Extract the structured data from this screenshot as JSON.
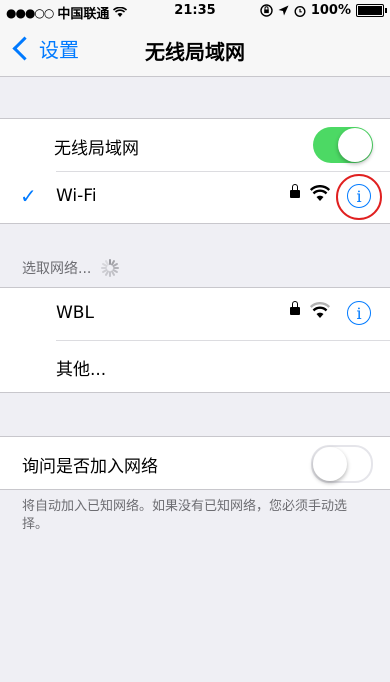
{
  "status_bar": {
    "signal_dots": "●●●○○",
    "carrier": "中国联通",
    "time": "21:35",
    "battery": "100%"
  },
  "nav": {
    "back_label": "设置",
    "title": "无线局域网"
  },
  "wifi_group": {
    "toggle_label": "无线局域网",
    "toggle_on": true,
    "connected_network": "Wi-Fi",
    "check_glyph": "✓",
    "info_glyph": "i"
  },
  "choose_network": {
    "header": "选取网络..."
  },
  "networks": [
    {
      "name": "WBL",
      "locked": true
    },
    {
      "name": "其他..."
    }
  ],
  "ask_join": {
    "label": "询问是否加入网络",
    "toggle_on": false,
    "footer": "将自动加入已知网络。如果没有已知网络，您必须手动选择。"
  },
  "colors": {
    "accent": "#007aff",
    "toggle_on": "#4cd964",
    "highlight_ring": "#e02020"
  }
}
